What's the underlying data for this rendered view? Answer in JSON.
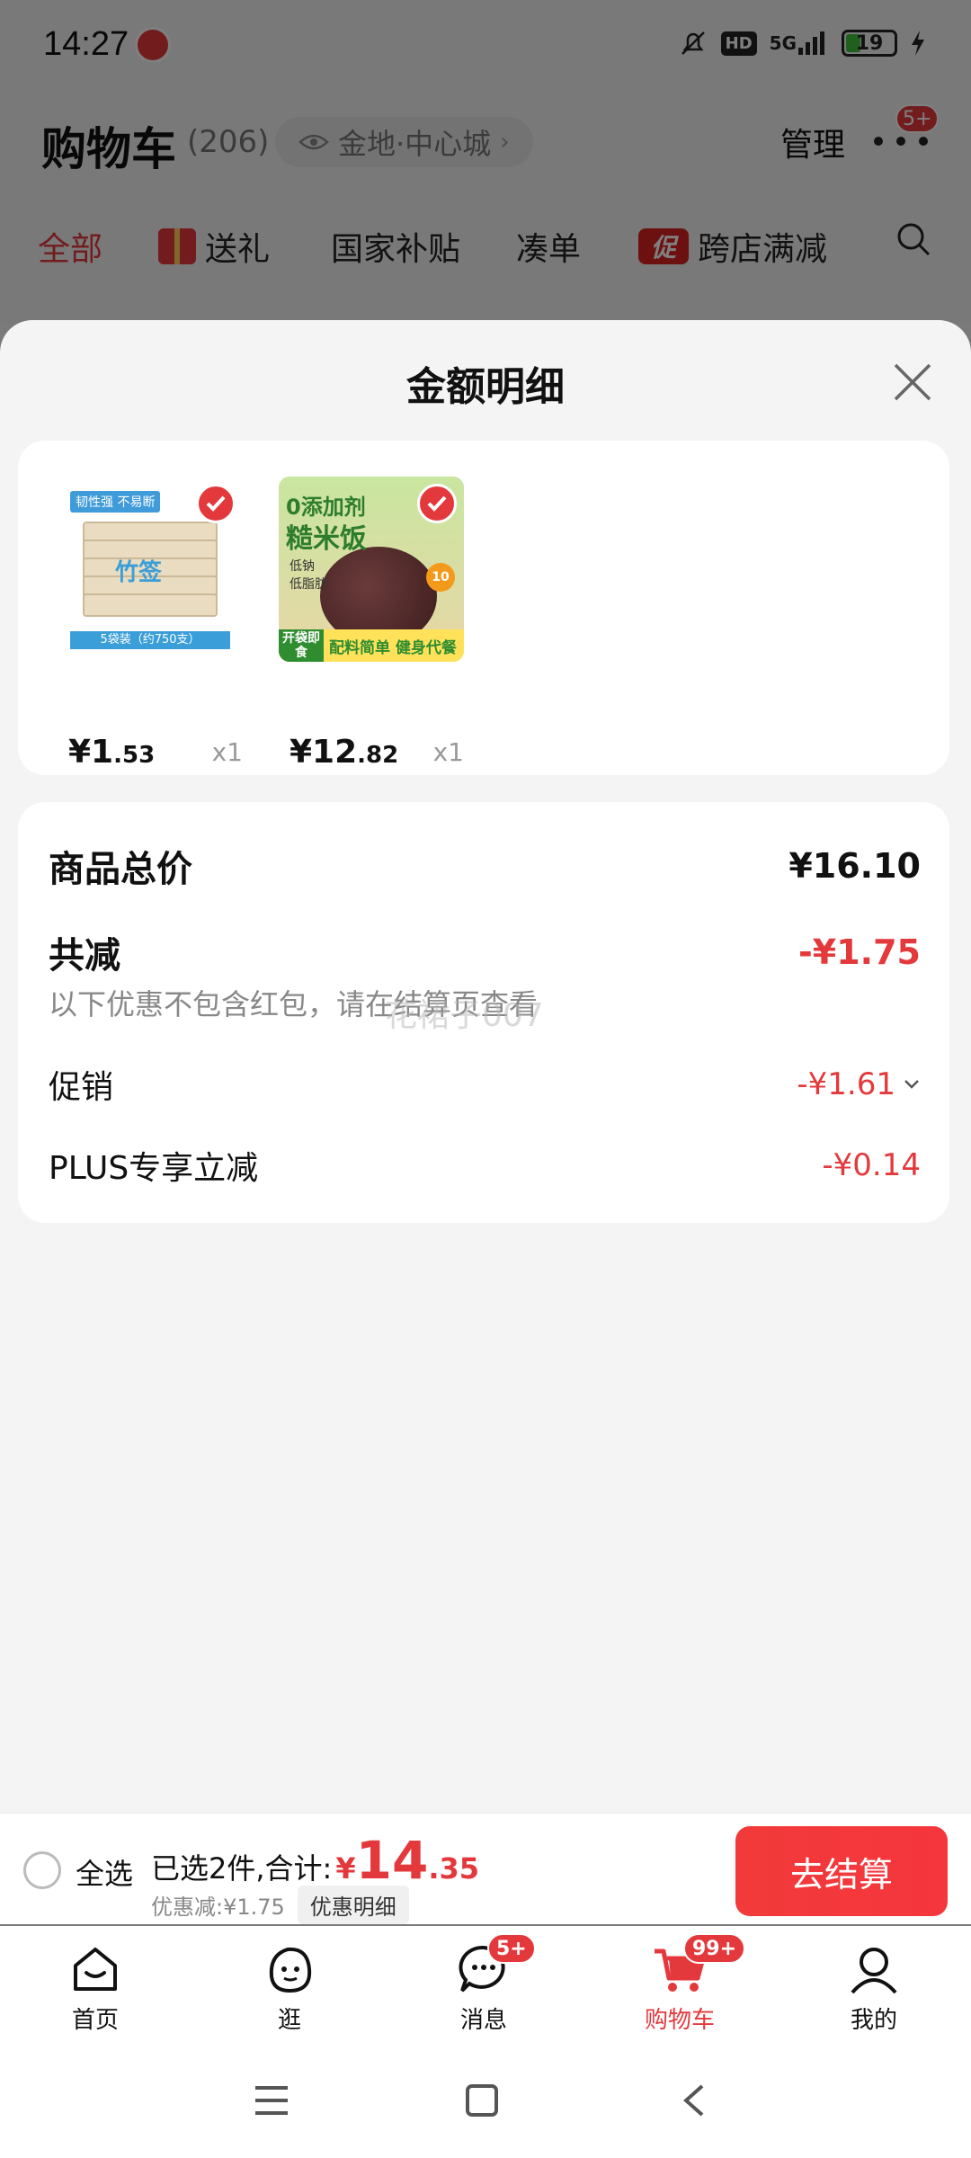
{
  "status_bar": {
    "time": "14:27",
    "network": "5G",
    "hd": "HD",
    "battery": "19"
  },
  "header": {
    "title": "购物车",
    "count": "(206)",
    "location": "金地·中心城",
    "manage": "管理",
    "more_badge": "5+"
  },
  "tabs": [
    {
      "label": "全部"
    },
    {
      "label": "送礼"
    },
    {
      "label": "国家补贴"
    },
    {
      "label": "凑单"
    },
    {
      "label": "跨店满减",
      "badge": "促"
    }
  ],
  "sheet": {
    "title": "金额明细",
    "products": [
      {
        "price_int": "¥1",
        "price_dec": ".53",
        "qty": "x1",
        "image": {
          "tag": "韧性强 不易断",
          "brand": "竹签",
          "label": "5袋装（约750支）"
        }
      },
      {
        "price_int": "¥12",
        "price_dec": ".82",
        "qty": "x1",
        "image": {
          "line1": "0添加剂",
          "line2": "糙米饭",
          "small1": "低钠",
          "small2": "低脂肪",
          "badge": "10",
          "open": "开袋即食",
          "slogan": "配料简单 健身代餐"
        }
      }
    ],
    "summary": {
      "total_label": "商品总价",
      "total_value": "¥16.10",
      "reduce_label": "共减",
      "reduce_value": "-¥1.75",
      "note": "以下优惠不包含红包，请在结算页查看",
      "watermark": "花裙子007",
      "promo_label": "促销",
      "promo_value": "-¥1.61",
      "plus_label": "PLUS专享立减",
      "plus_value": "-¥0.14"
    }
  },
  "checkout": {
    "select_all": "全选",
    "selected_text": "已选2件,合计:",
    "yen": "¥",
    "total_int": "14",
    "total_dec": ".35",
    "discount_text": "优惠减:¥1.75",
    "detail_btn": "优惠明细",
    "checkout_btn": "去结算"
  },
  "nav": [
    {
      "label": "首页"
    },
    {
      "label": "逛"
    },
    {
      "label": "消息",
      "badge": "5+"
    },
    {
      "label": "购物车",
      "badge": "99+"
    },
    {
      "label": "我的"
    }
  ],
  "colors": {
    "accent": "#e4393c",
    "page_bg": "#f4f4f4"
  }
}
